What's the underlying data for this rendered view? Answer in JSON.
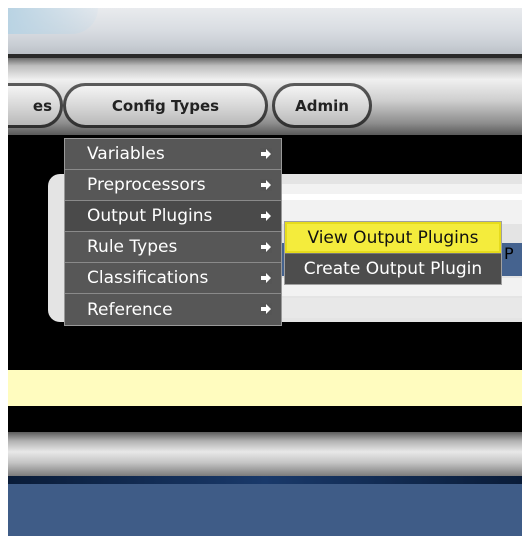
{
  "tabs": [
    {
      "label": "es"
    },
    {
      "label": "Config Types"
    },
    {
      "label": "Admin"
    }
  ],
  "menu": {
    "items": [
      {
        "label": "Variables"
      },
      {
        "label": "Preprocessors"
      },
      {
        "label": "Output Plugins"
      },
      {
        "label": "Rule Types"
      },
      {
        "label": "Classifications"
      },
      {
        "label": "Reference"
      }
    ]
  },
  "submenu": {
    "items": [
      {
        "label": "View Output Plugins"
      },
      {
        "label": "Create Output Plugin"
      }
    ]
  },
  "background_text": "P",
  "colors": {
    "menu_bg": "#555555",
    "highlight": "#f4ec3c",
    "panel_blue": "#45638f",
    "yellow_bar": "#fffcbf",
    "footer": "#3f5c87"
  }
}
